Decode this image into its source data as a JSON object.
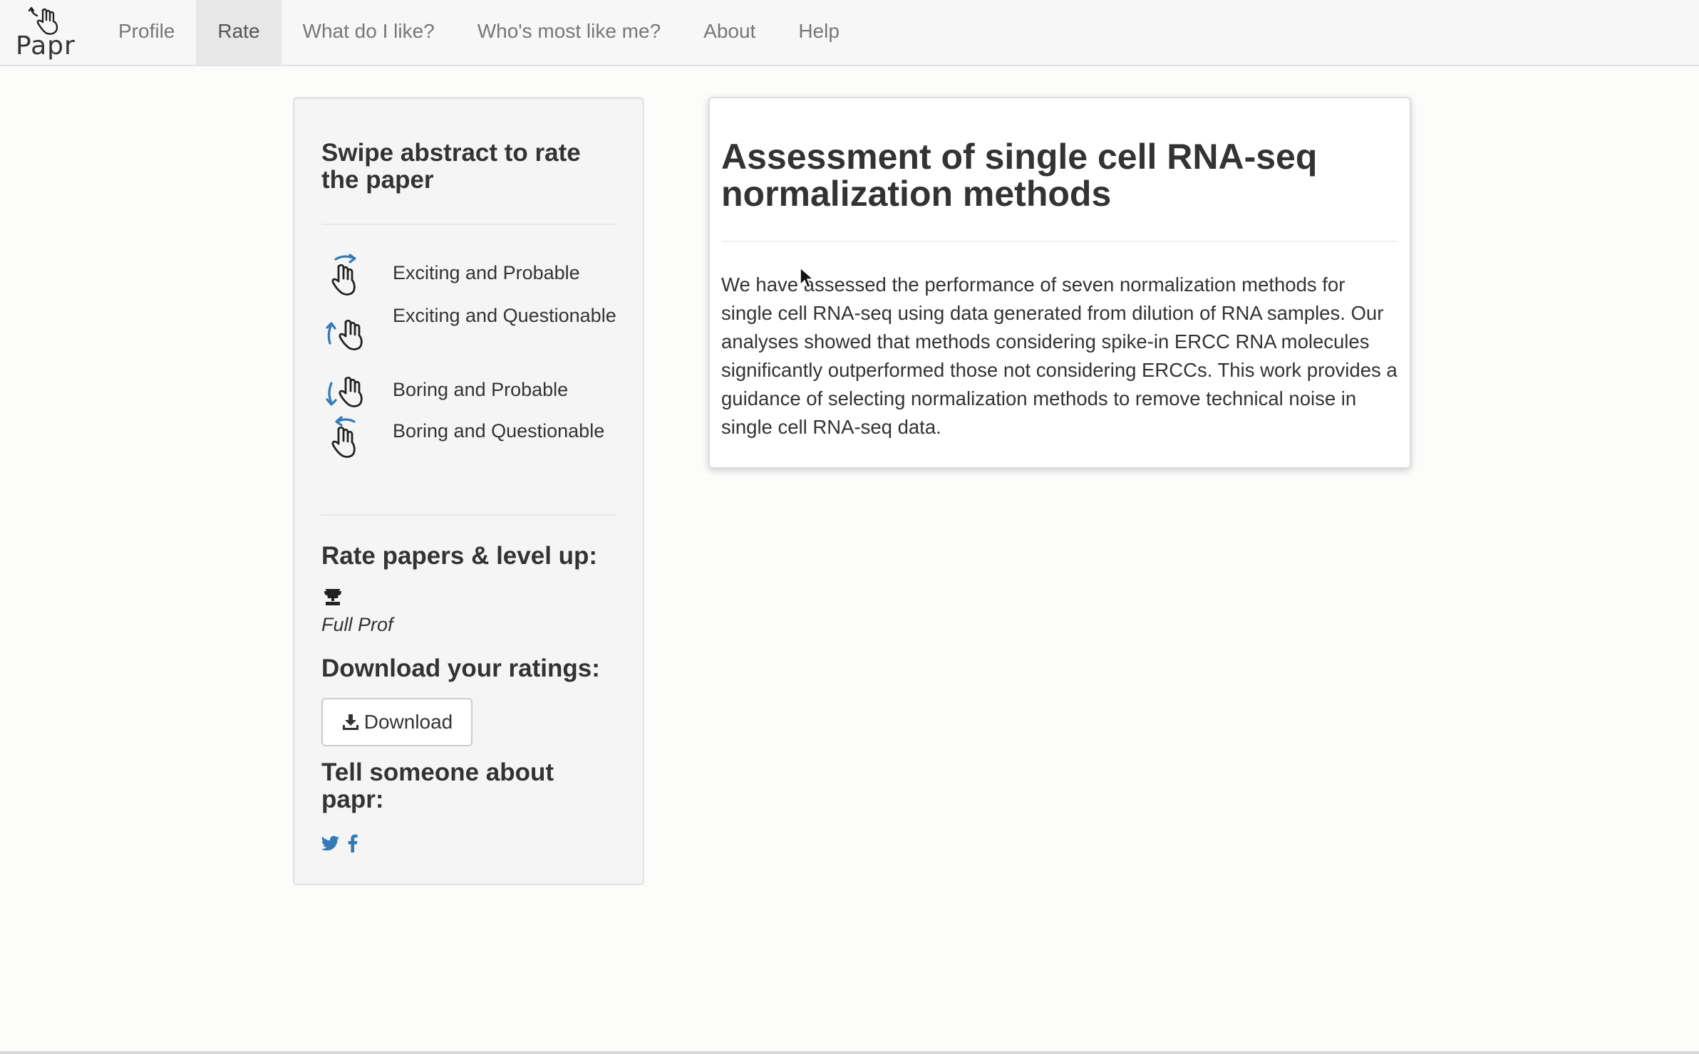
{
  "brand": {
    "name": "Papr",
    "icon": "pointing-hand-icon"
  },
  "nav": {
    "items": [
      {
        "label": "Profile",
        "active": false
      },
      {
        "label": "Rate",
        "active": true
      },
      {
        "label": "What do I like?",
        "active": false
      },
      {
        "label": "Who's most like me?",
        "active": false
      },
      {
        "label": "About",
        "active": false
      },
      {
        "label": "Help",
        "active": false
      }
    ]
  },
  "sidebar": {
    "swipe_title": "Swipe abstract to rate the paper",
    "legend": [
      {
        "label": "Exciting and Probable",
        "icon": "swipe-right-icon"
      },
      {
        "label": "Exciting and Questionable",
        "icon": "swipe-up-icon"
      },
      {
        "label": "Boring and Probable",
        "icon": "swipe-down-icon"
      },
      {
        "label": "Boring and Questionable",
        "icon": "swipe-left-icon"
      }
    ],
    "level_title": "Rate papers & level up:",
    "level_icon": "trophy-icon",
    "level_name": "Full Prof",
    "download_title": "Download your ratings:",
    "download_button": "Download",
    "tell_title": "Tell someone about papr:",
    "social": [
      {
        "name": "twitter",
        "icon": "twitter-icon"
      },
      {
        "name": "facebook",
        "icon": "facebook-icon"
      }
    ]
  },
  "paper": {
    "title": "Assessment of single cell RNA-seq normalization methods",
    "abstract": "We have assessed the performance of seven normalization methods for single cell RNA-seq using data generated from dilution of RNA samples. Our analyses showed that methods considering spike-in ERCC RNA molecules significantly outperformed those not considering ERCCs. This work provides a guidance of selecting normalization methods to remove technical noise in single cell RNA-seq data."
  },
  "colors": {
    "accent": "#337ab7",
    "nav_active_bg": "#e7e7e7",
    "well_bg": "#f5f5f5"
  }
}
